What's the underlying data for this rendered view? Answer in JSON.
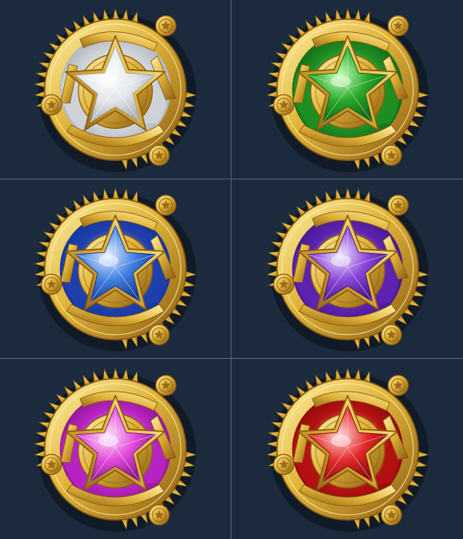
{
  "medals": [
    {
      "id": "white",
      "icon": "star-medal-icon",
      "gem_light": "#ffffff",
      "gem_mid": "#e3e6ea",
      "gem_dark": "#9ea5ad",
      "backing": "#cfd3d8"
    },
    {
      "id": "green",
      "icon": "star-medal-icon",
      "gem_light": "#c8ffb8",
      "gem_mid": "#29a82c",
      "gem_dark": "#0c5a12",
      "backing": "#1f8f22"
    },
    {
      "id": "blue",
      "icon": "star-medal-icon",
      "gem_light": "#e4f1ff",
      "gem_mid": "#3f7ee0",
      "gem_dark": "#10308f",
      "backing": "#1f3fae"
    },
    {
      "id": "purple",
      "icon": "star-medal-icon",
      "gem_light": "#f0e4ff",
      "gem_mid": "#8a45d8",
      "gem_dark": "#3d1282",
      "backing": "#5d23b0"
    },
    {
      "id": "pink",
      "icon": "star-medal-icon",
      "gem_light": "#ffe4fb",
      "gem_mid": "#e04ad8",
      "gem_dark": "#7d1080",
      "backing": "#b824c4"
    },
    {
      "id": "red",
      "icon": "star-medal-icon",
      "gem_light": "#ffd6d6",
      "gem_mid": "#e32a2a",
      "gem_dark": "#7a0707",
      "backing": "#b51212"
    }
  ],
  "colors": {
    "background": "#1b2a3c",
    "divider": "#5a6475",
    "gold_light": "#fff2a8",
    "gold_mid": "#e0b43a",
    "gold_dark": "#8a5a10"
  }
}
